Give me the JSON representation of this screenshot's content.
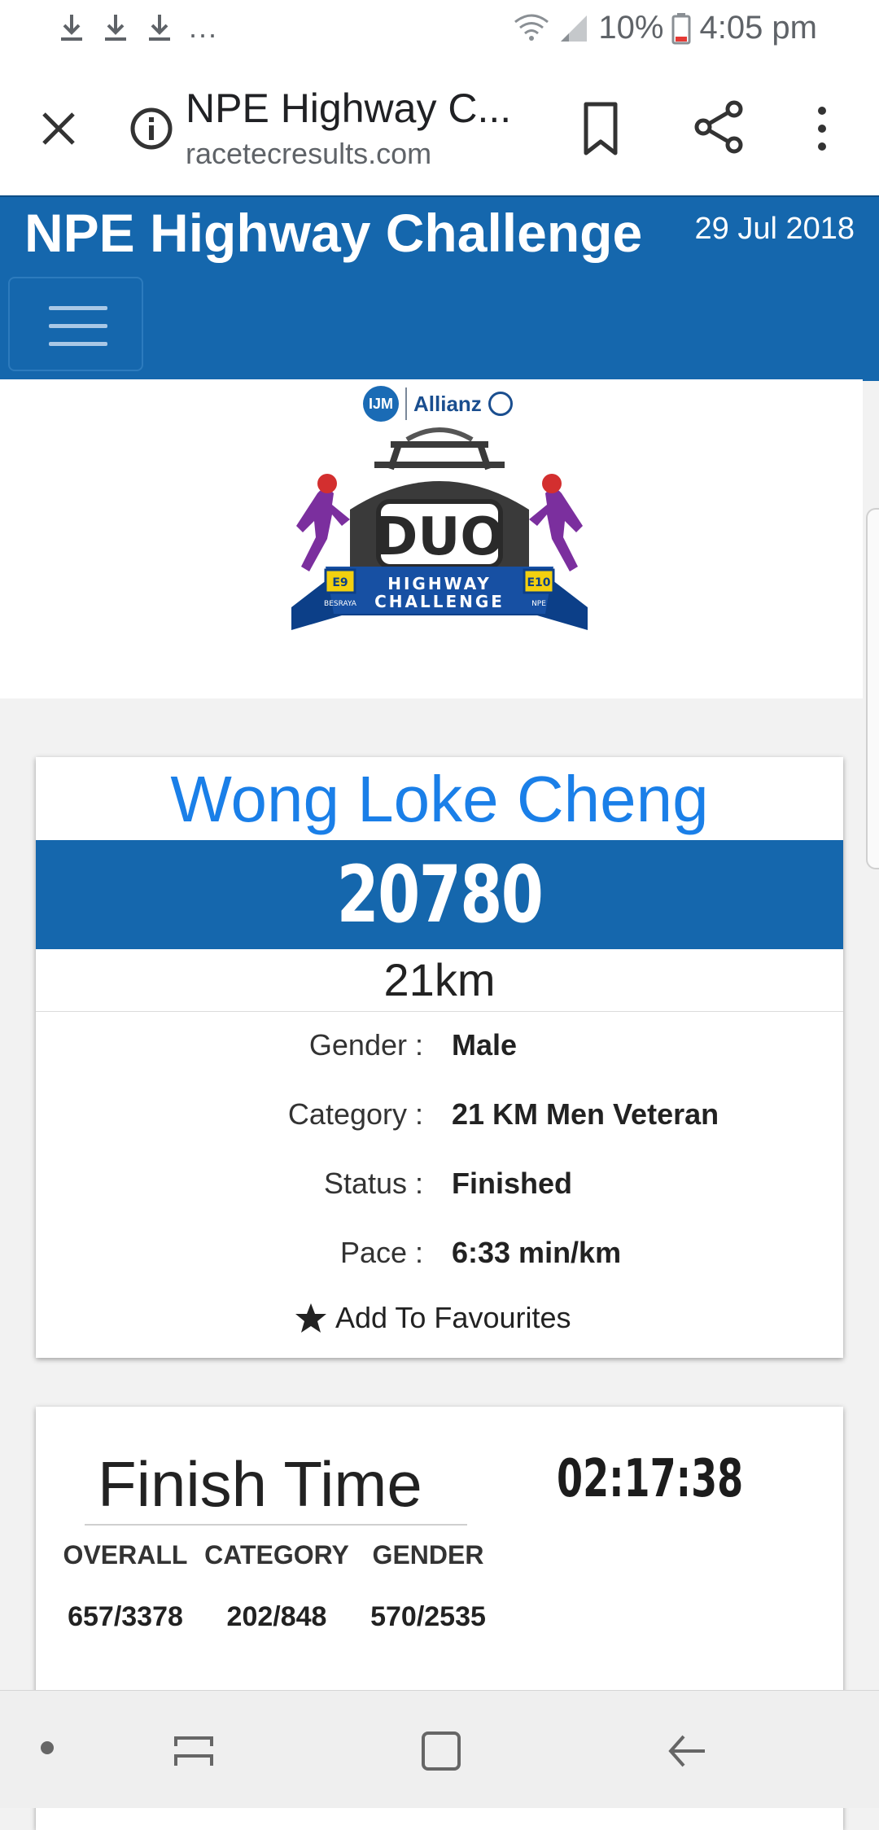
{
  "status_bar": {
    "overflow": "...",
    "battery": "10%",
    "time": "4:05 pm",
    "icons": [
      "download-icon",
      "download-icon",
      "download-icon",
      "wifi-icon",
      "signal-icon",
      "battery-icon"
    ]
  },
  "browser": {
    "page_title": "NPE Highway C...",
    "url": "racetecresults.com",
    "icons": [
      "close-icon",
      "info-icon",
      "bookmark-icon",
      "share-icon",
      "more-vert-icon"
    ]
  },
  "site": {
    "event_title": "NPE Highway Challenge",
    "event_date": "29 Jul 2018",
    "brand_color": "#1567ad",
    "logo": {
      "sponsor_left": "IJM",
      "sponsor_right": "Allianz",
      "duo_text": "DUO",
      "banner_line1": "HIGHWAY",
      "banner_line2": "CHALLENGE",
      "left_road": "E9",
      "left_road_sub": "BESRAYA",
      "right_road": "E10",
      "right_road_sub": "NPE"
    }
  },
  "runner": {
    "name": "Wong Loke Cheng",
    "bib": "20780",
    "distance": "21km",
    "details": [
      {
        "label": "Gender :",
        "value": "Male"
      },
      {
        "label": "Category :",
        "value": "21 KM Men Veteran"
      },
      {
        "label": "Status :",
        "value": "Finished"
      },
      {
        "label": "Pace :",
        "value": "6:33 min/km"
      }
    ],
    "favourites_label": "Add To Favourites",
    "name_color": "#1a7fe8"
  },
  "result": {
    "finish_label": "Finish Time",
    "finish_time": "02:17:38",
    "ranks": [
      {
        "header": "OVERALL",
        "value": "657/3378"
      },
      {
        "header": "CATEGORY",
        "value": "202/848"
      },
      {
        "header": "GENDER",
        "value": "570/2535"
      }
    ]
  }
}
